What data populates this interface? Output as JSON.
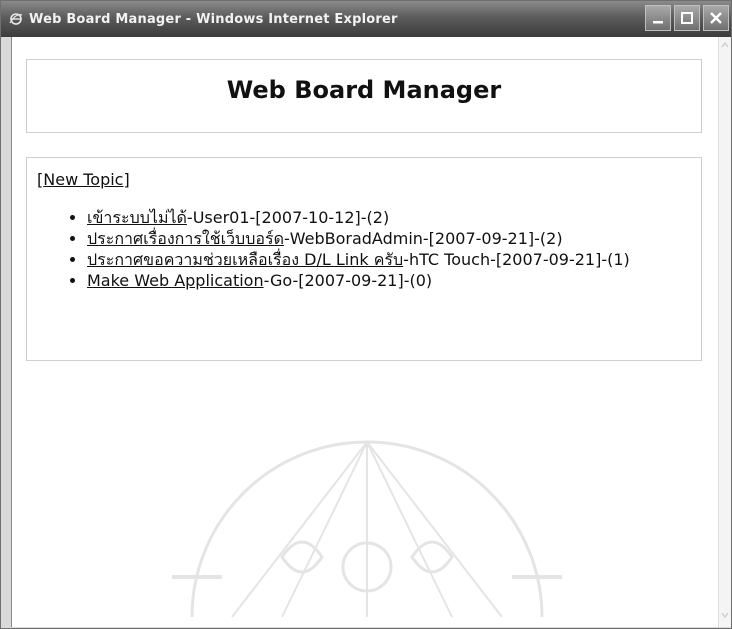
{
  "window": {
    "title": "Web Board Manager - Windows Internet Explorer"
  },
  "page": {
    "heading": "Web Board Manager",
    "new_topic_open": "[",
    "new_topic_label": "New Topic",
    "new_topic_close": "]"
  },
  "topics": [
    {
      "title": "เข้าระบบไม่ได้",
      "meta": "-User01-[2007-10-12]-(2)"
    },
    {
      "title": "ประกาศเรื่องการใช้เว็บบอร์ด",
      "meta": "-WebBoradAdmin-[2007-09-21]-(2)"
    },
    {
      "title": "ประกาศขอความช่วยเหลือเรื่อง D/L Link ครับ",
      "meta": "-hTC Touch-[2007-09-21]-(1)"
    },
    {
      "title": "Make Web Application",
      "meta": "-Go-[2007-09-21]-(0)"
    }
  ],
  "icons": {
    "browser": "ie-logo-icon",
    "minimize": "minimize-icon",
    "maximize": "maximize-icon",
    "close": "close-icon"
  },
  "colors": {
    "titlebar_dark": "#3b3b3b",
    "titlebar_light": "#8a8a8a",
    "text": "#111111",
    "box_border": "#cfcfcf"
  }
}
